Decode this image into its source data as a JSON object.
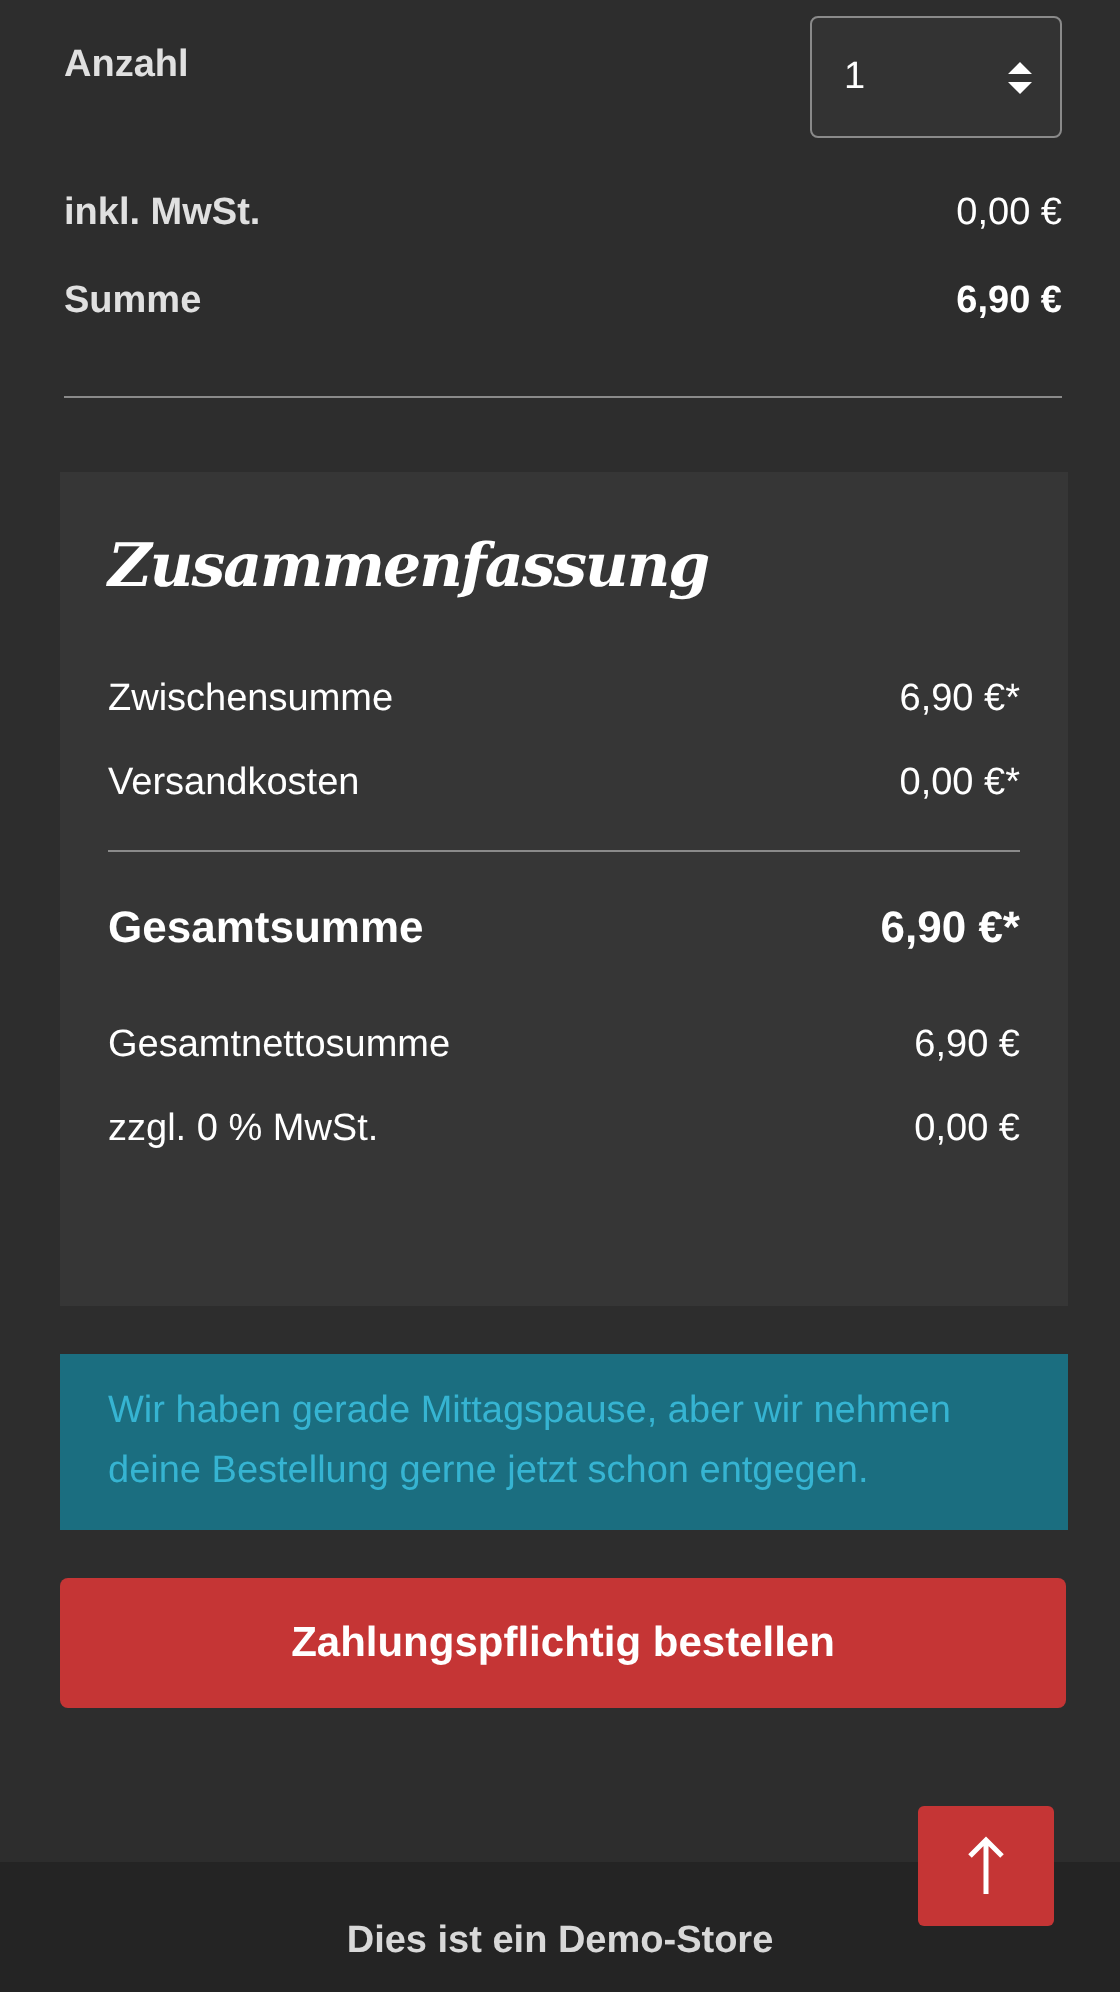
{
  "quantity": {
    "label": "Anzahl",
    "value": "1"
  },
  "price_lines": [
    {
      "label": "inkl. MwSt.",
      "value": "0,00 €",
      "kind": "normal"
    },
    {
      "label": "Summe",
      "value": "6,90 €",
      "kind": "total"
    }
  ],
  "summary": {
    "title": "Zusammenfassung",
    "rows": [
      {
        "label": "Zwischensumme",
        "value": "6,90 €*",
        "kind": "normal"
      },
      {
        "label": "Versandkosten",
        "value": "0,00 €*",
        "kind": "normal"
      },
      {
        "label": "Gesamtsumme",
        "value": "6,90 €*",
        "kind": "total"
      },
      {
        "label": "Gesamtnettosumme",
        "value": "6,90 €",
        "kind": "normal"
      },
      {
        "label": "zzgl. 0 % MwSt.",
        "value": "0,00 €",
        "kind": "normal"
      }
    ]
  },
  "notice": "Wir haben gerade Mittagspause, aber wir nehmen deine Bestellung gerne jetzt schon entgegen.",
  "order_button": "Zahlungspflichtig bestellen",
  "footer": "Dies ist ein Demo-Store"
}
